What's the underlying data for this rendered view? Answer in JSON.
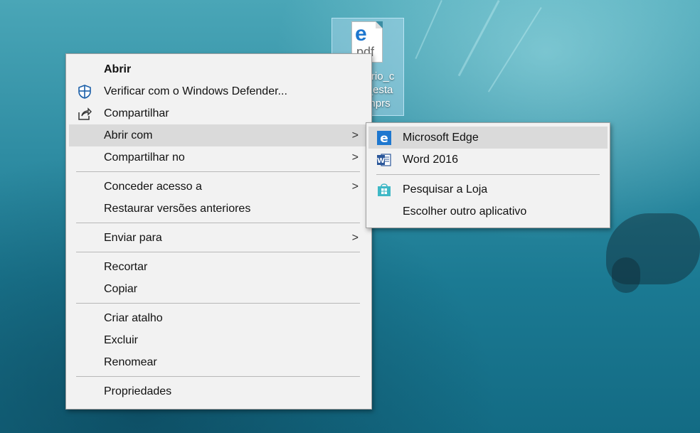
{
  "desktop": {
    "icon": {
      "doc_ext": "pdf",
      "label_lines": [
        "ario_c",
        "_esta",
        "nprs"
      ]
    }
  },
  "context_menu": {
    "items": [
      {
        "label": "Abrir",
        "bold": true
      },
      {
        "label": "Verificar com o Windows Defender...",
        "icon": "shield-icon"
      },
      {
        "label": "Compartilhar",
        "icon": "share-icon"
      },
      {
        "label": "Abrir com",
        "submenu": true,
        "highlighted": true
      },
      {
        "label": "Compartilhar no",
        "submenu": true
      },
      {
        "label": "Conceder acesso a",
        "submenu": true
      },
      {
        "label": "Restaurar versões anteriores"
      },
      {
        "label": "Enviar para",
        "submenu": true
      },
      {
        "label": "Recortar"
      },
      {
        "label": "Copiar"
      },
      {
        "label": "Criar atalho"
      },
      {
        "label": "Excluir"
      },
      {
        "label": "Renomear"
      },
      {
        "label": "Propriedades"
      }
    ]
  },
  "open_with_submenu": {
    "items": [
      {
        "label": "Microsoft Edge",
        "icon": "edge-icon",
        "highlighted": true
      },
      {
        "label": "Word 2016",
        "icon": "word-icon"
      },
      {
        "label": "Pesquisar a Loja",
        "icon": "store-icon"
      },
      {
        "label": "Escolher outro aplicativo"
      }
    ]
  },
  "colors": {
    "menu_bg": "#f2f2f2",
    "highlight": "#dadada",
    "edge_blue": "#1e77cf",
    "word_blue": "#2b579a",
    "store_teal": "#3fb8c6"
  }
}
